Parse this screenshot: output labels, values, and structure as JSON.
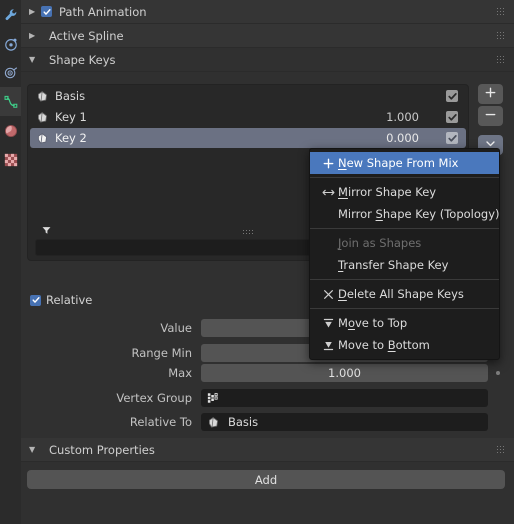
{
  "app": {
    "theme_bg": "#303030",
    "accent": "#4772b3",
    "menu_highlight": "#4a78bd"
  },
  "rail": {
    "items": [
      {
        "name": "modifier-properties-tab",
        "icon": "wrench-icon",
        "color": "#6ea8dd",
        "active": false
      },
      {
        "name": "physics-properties-tab",
        "icon": "physics-icon",
        "color": "#85a9d8",
        "active": false
      },
      {
        "name": "object-constraint-properties-tab",
        "icon": "constraint-icon",
        "color": "#8fa8cf",
        "active": false
      },
      {
        "name": "object-data-properties-tab",
        "icon": "curve-data-icon",
        "color": "#3fd18b",
        "active": true
      },
      {
        "name": "material-properties-tab",
        "icon": "material-icon",
        "color": "#c96a6a",
        "active": false
      },
      {
        "name": "texture-properties-tab",
        "icon": "texture-checker-icon",
        "color": "#cc7a7a",
        "active": false
      }
    ]
  },
  "panels": [
    {
      "name": "panel-path-animation",
      "label": "Path Animation",
      "expanded": false,
      "checkbox": true,
      "checked": true
    },
    {
      "name": "panel-active-spline",
      "label": "Active Spline",
      "expanded": false,
      "checkbox": false,
      "checked": false
    },
    {
      "name": "panel-shape-keys",
      "label": "Shape Keys",
      "expanded": true,
      "checkbox": false,
      "checked": false
    }
  ],
  "shape_keys": {
    "columns": [
      "name",
      "value",
      "mute"
    ],
    "rows": [
      {
        "name": "Basis",
        "value": "",
        "enabled": true,
        "selected": false
      },
      {
        "name": "Key 1",
        "value": "1.000",
        "enabled": true,
        "selected": false
      },
      {
        "name": "Key 2",
        "value": "0.000",
        "enabled": true,
        "selected": true
      }
    ],
    "search_value": "",
    "side_buttons": [
      {
        "name": "add-shape-key-button",
        "icon": "plus-icon",
        "glyph": "+",
        "state": "normal"
      },
      {
        "name": "remove-shape-key-button",
        "icon": "minus-icon",
        "glyph": "−",
        "state": "normal"
      },
      {
        "name": "shape-key-specials-menu-button",
        "icon": "chevron-down-icon",
        "glyph": "⌄",
        "state": "active"
      }
    ],
    "filter_icon": "filter-funnel-icon"
  },
  "relative": {
    "label": "Relative",
    "checked": true
  },
  "properties": [
    {
      "name": "value-field",
      "label": "Value",
      "value": "0.000",
      "style": "slider",
      "has_decorator": true
    },
    {
      "name": "range-min-field",
      "label": "Range Min",
      "value": "0.000",
      "style": "slider",
      "has_decorator": true
    },
    {
      "name": "range-max-field",
      "label": "Max",
      "value": "1.000",
      "style": "slider",
      "has_decorator": true
    },
    {
      "name": "vertex-group-field",
      "label": "Vertex Group",
      "value": "",
      "style": "search",
      "icon": "vertex-group-icon",
      "has_decorator": false
    },
    {
      "name": "relative-to-field",
      "label": "Relative To",
      "value": "Basis",
      "style": "search",
      "icon": "shapekey-icon",
      "has_decorator": false
    }
  ],
  "specials_menu": {
    "name": "shape-key-specials-menu",
    "items": [
      {
        "name": "menu-new-shape-from-mix",
        "label": "New Shape From Mix",
        "accel": "N",
        "icon": "plus-icon",
        "highlighted": true,
        "disabled": false
      },
      {
        "separator": true
      },
      {
        "name": "menu-mirror-shape-key",
        "label": "Mirror Shape Key",
        "accel": "M",
        "icon": "arrows-left-right-icon",
        "highlighted": false,
        "disabled": false
      },
      {
        "name": "menu-mirror-shape-key-topology",
        "label": "Mirror Shape Key (Topology)",
        "accel": "S",
        "icon": "none",
        "highlighted": false,
        "disabled": false
      },
      {
        "separator": true
      },
      {
        "name": "menu-join-as-shapes",
        "label": "Join as Shapes",
        "accel": "J",
        "icon": "none",
        "highlighted": false,
        "disabled": true
      },
      {
        "name": "menu-transfer-shape-key",
        "label": "Transfer Shape Key",
        "accel": "T",
        "icon": "none",
        "highlighted": false,
        "disabled": false
      },
      {
        "separator": true
      },
      {
        "name": "menu-delete-all-shape-keys",
        "label": "Delete All Shape Keys",
        "accel": "D",
        "icon": "x-icon",
        "highlighted": false,
        "disabled": false
      },
      {
        "separator": true
      },
      {
        "name": "menu-move-to-top",
        "label": "Move to Top",
        "accel": "o",
        "icon": "move-to-top-icon",
        "highlighted": false,
        "disabled": false
      },
      {
        "name": "menu-move-to-bottom",
        "label": "Move to Bottom",
        "accel": "B",
        "icon": "move-to-bottom-icon",
        "highlighted": false,
        "disabled": false
      }
    ]
  },
  "custom_properties": {
    "name": "panel-custom-properties",
    "label": "Custom Properties",
    "expanded": true,
    "add_label": "Add"
  }
}
